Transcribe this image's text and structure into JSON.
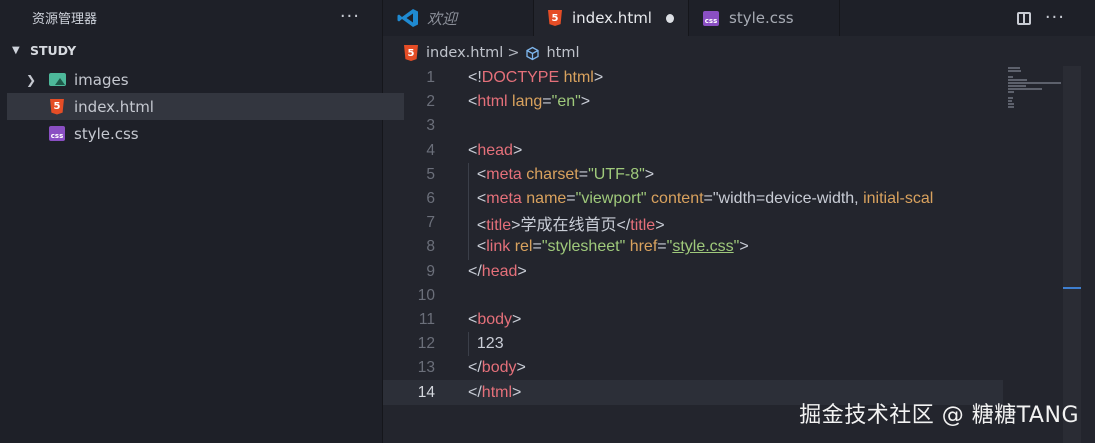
{
  "sidebar": {
    "title": "资源管理器",
    "more": "···",
    "section": "STUDY",
    "items": [
      {
        "label": "images",
        "type": "folder"
      },
      {
        "label": "index.html",
        "type": "html"
      },
      {
        "label": "style.css",
        "type": "css"
      }
    ]
  },
  "tabs": [
    {
      "label": "欢迎",
      "icon": "vscode-logo-icon"
    },
    {
      "label": "index.html",
      "icon": "html5-icon"
    },
    {
      "label": "style.css",
      "icon": "css-icon"
    }
  ],
  "tab_actions": {
    "more": "···"
  },
  "breadcrumb": {
    "file": "index.html",
    "separator": ">",
    "symbol": "html"
  },
  "editor": {
    "line_numbers": [
      "1",
      "2",
      "3",
      "4",
      "5",
      "6",
      "7",
      "8",
      "9",
      "10",
      "11",
      "12",
      "13",
      "14"
    ],
    "lines": [
      "<!DOCTYPE html>",
      "<html lang=\"en\">",
      "",
      "<head>",
      "  <meta charset=\"UTF-8\">",
      "  <meta name=\"viewport\" content=\"width=device-width, initial-scale",
      "  <title>学成在线首页</title>",
      "  <link rel=\"stylesheet\" href=\"style.css\">",
      "</head>",
      "",
      "<body>",
      "  123",
      "</body>",
      "</html>"
    ],
    "current_line": 14
  },
  "watermark": "掘金技术社区 @ 糖糖TANG",
  "colors": {
    "tag": "#e5707a",
    "attr": "#d9a25e",
    "string": "#9fc97b",
    "html5": "#e54d26",
    "css": "#8a4fc3"
  }
}
